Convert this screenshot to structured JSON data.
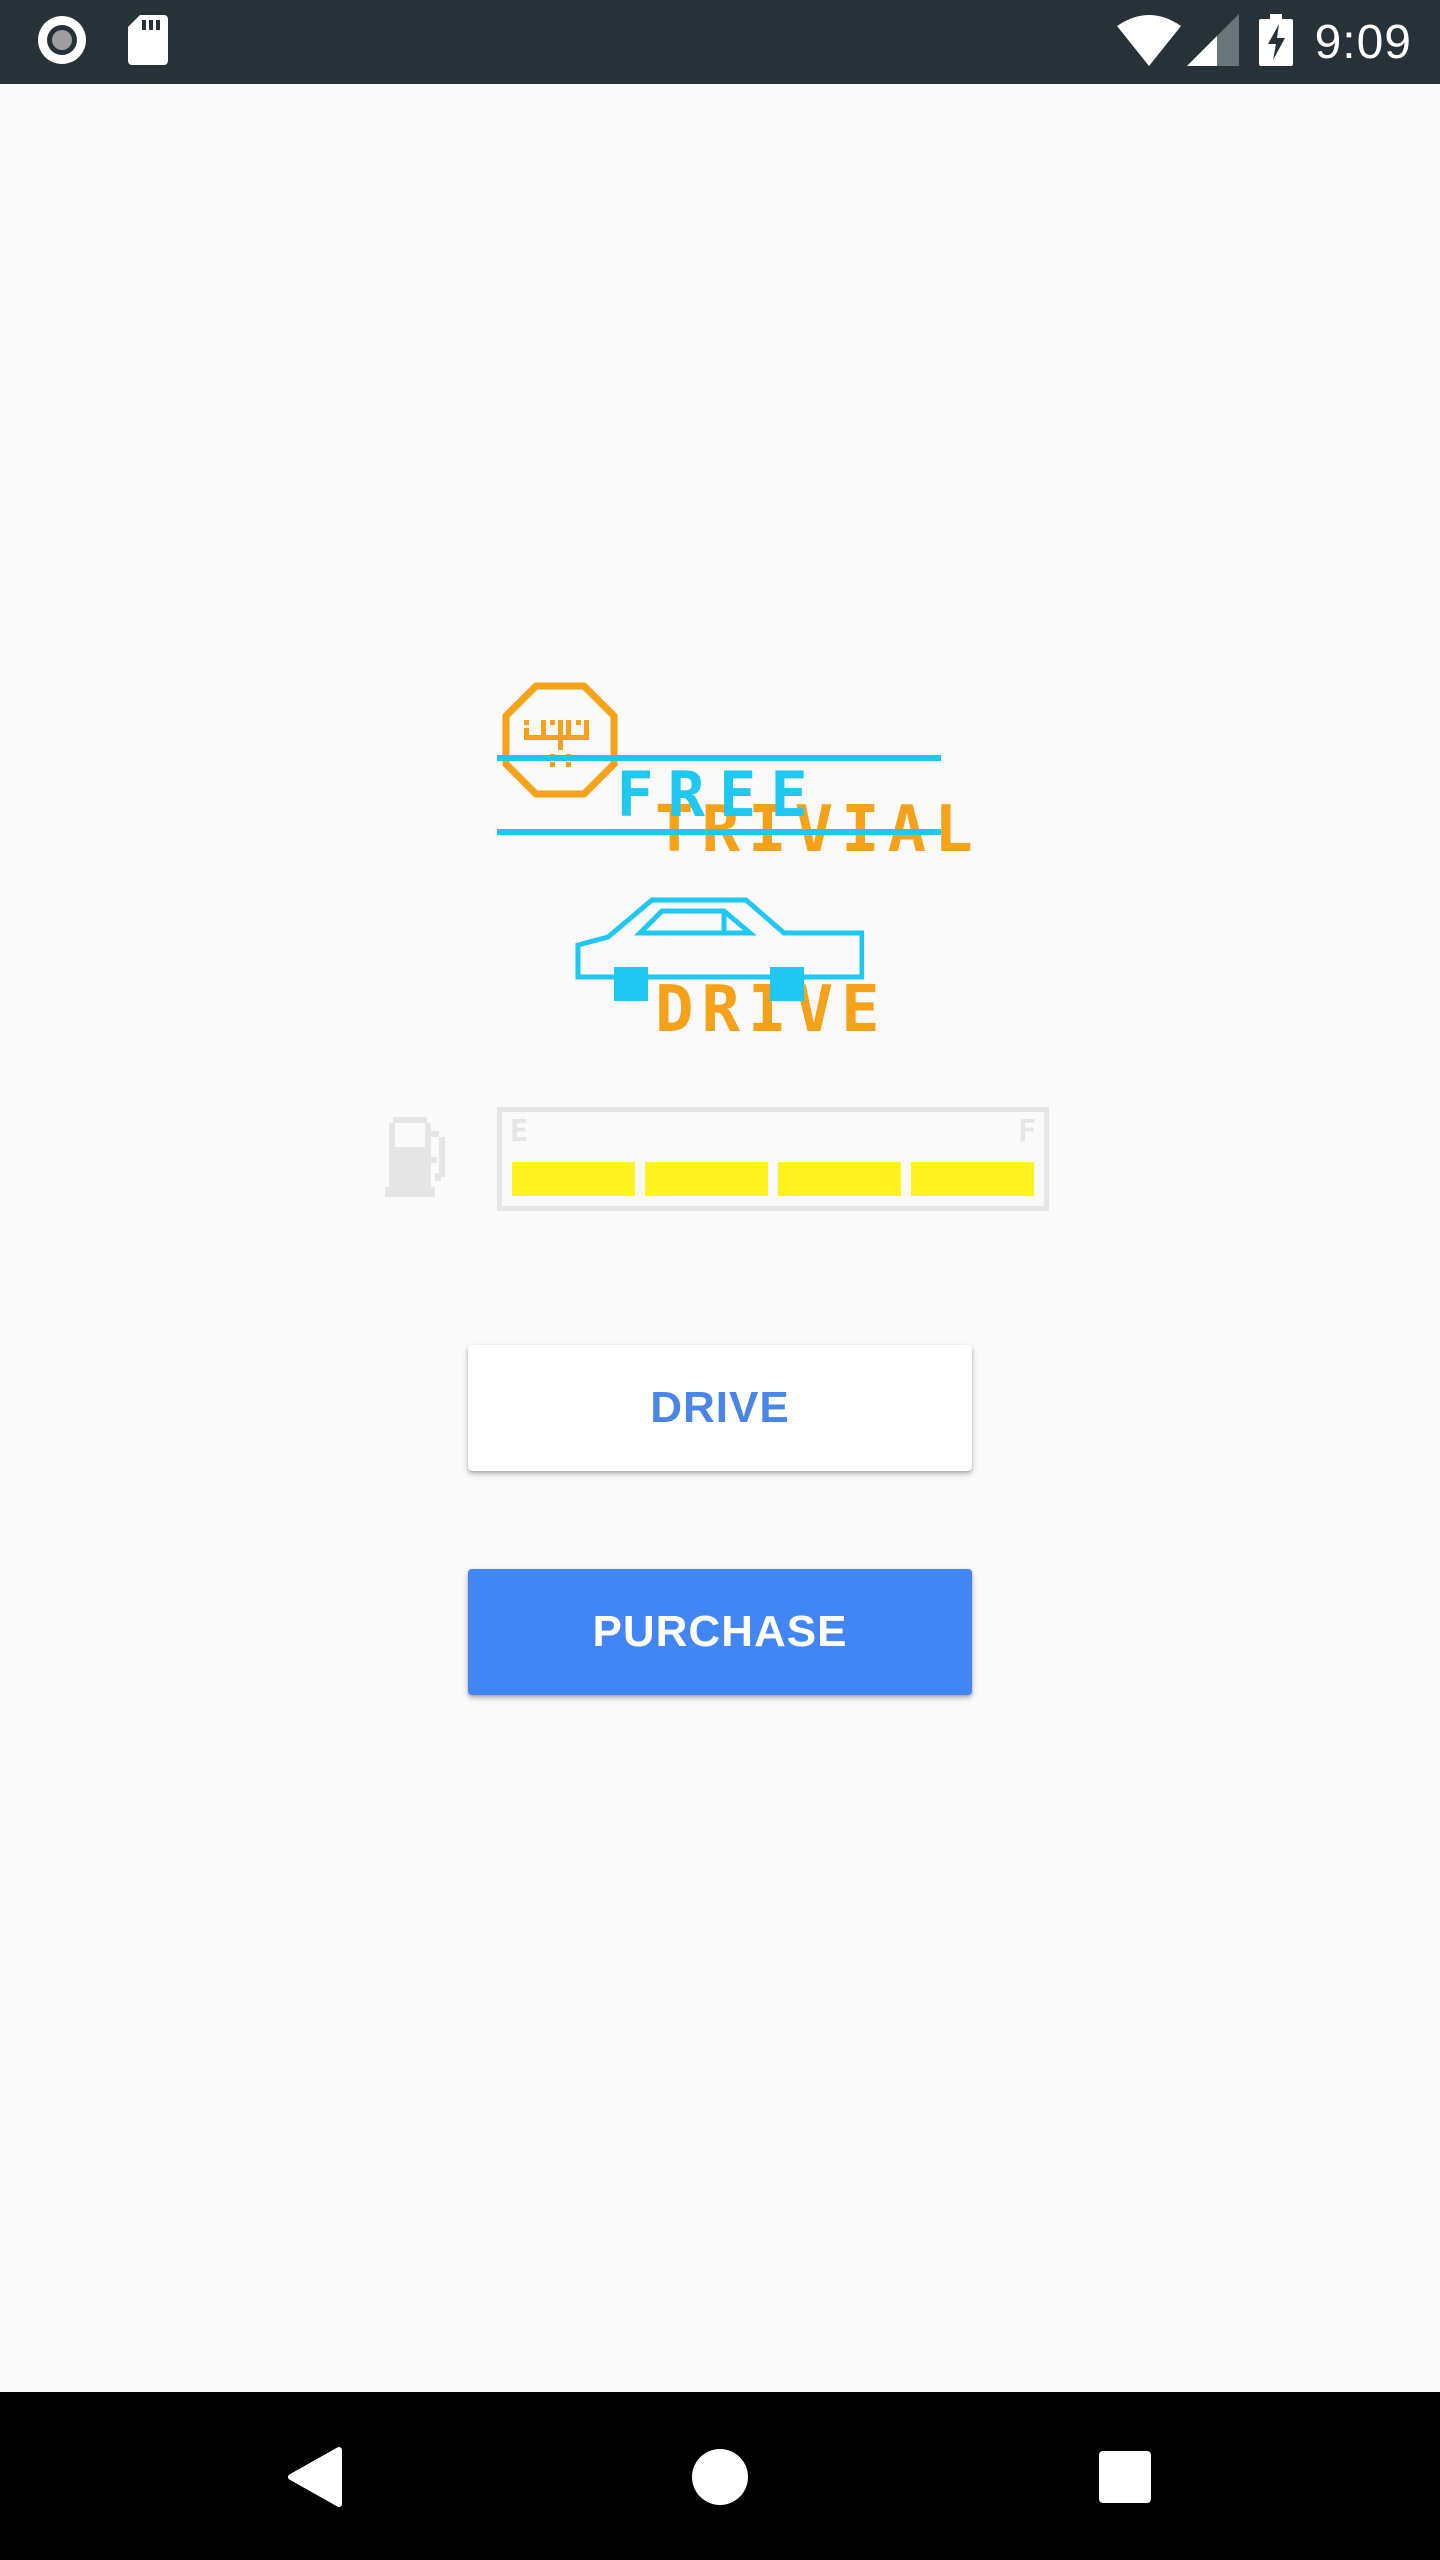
{
  "status_bar": {
    "time": "9:09",
    "icons": [
      "record-icon",
      "sd-card-icon",
      "wifi-icon",
      "cell-signal-icon",
      "battery-charging-icon"
    ]
  },
  "logo": {
    "title_line1": "TRIVIAL",
    "title_line2": "DRIVE",
    "emblem": "gear-shift-icon",
    "color": "#f5a11a"
  },
  "tier": {
    "label": "FREE",
    "color": "#1ec8f0"
  },
  "car": {
    "icon": "car-icon",
    "color": "#1ec8f0"
  },
  "fuel_gauge": {
    "icon": "fuel-pump-icon",
    "empty_label": "E",
    "full_label": "F",
    "level": 4,
    "max_level": 4,
    "bar_color": "#fff21f"
  },
  "buttons": {
    "drive_label": "DRIVE",
    "purchase_label": "PURCHASE"
  },
  "nav_bar": {
    "icons": [
      "back-icon",
      "home-icon",
      "recents-icon"
    ]
  }
}
